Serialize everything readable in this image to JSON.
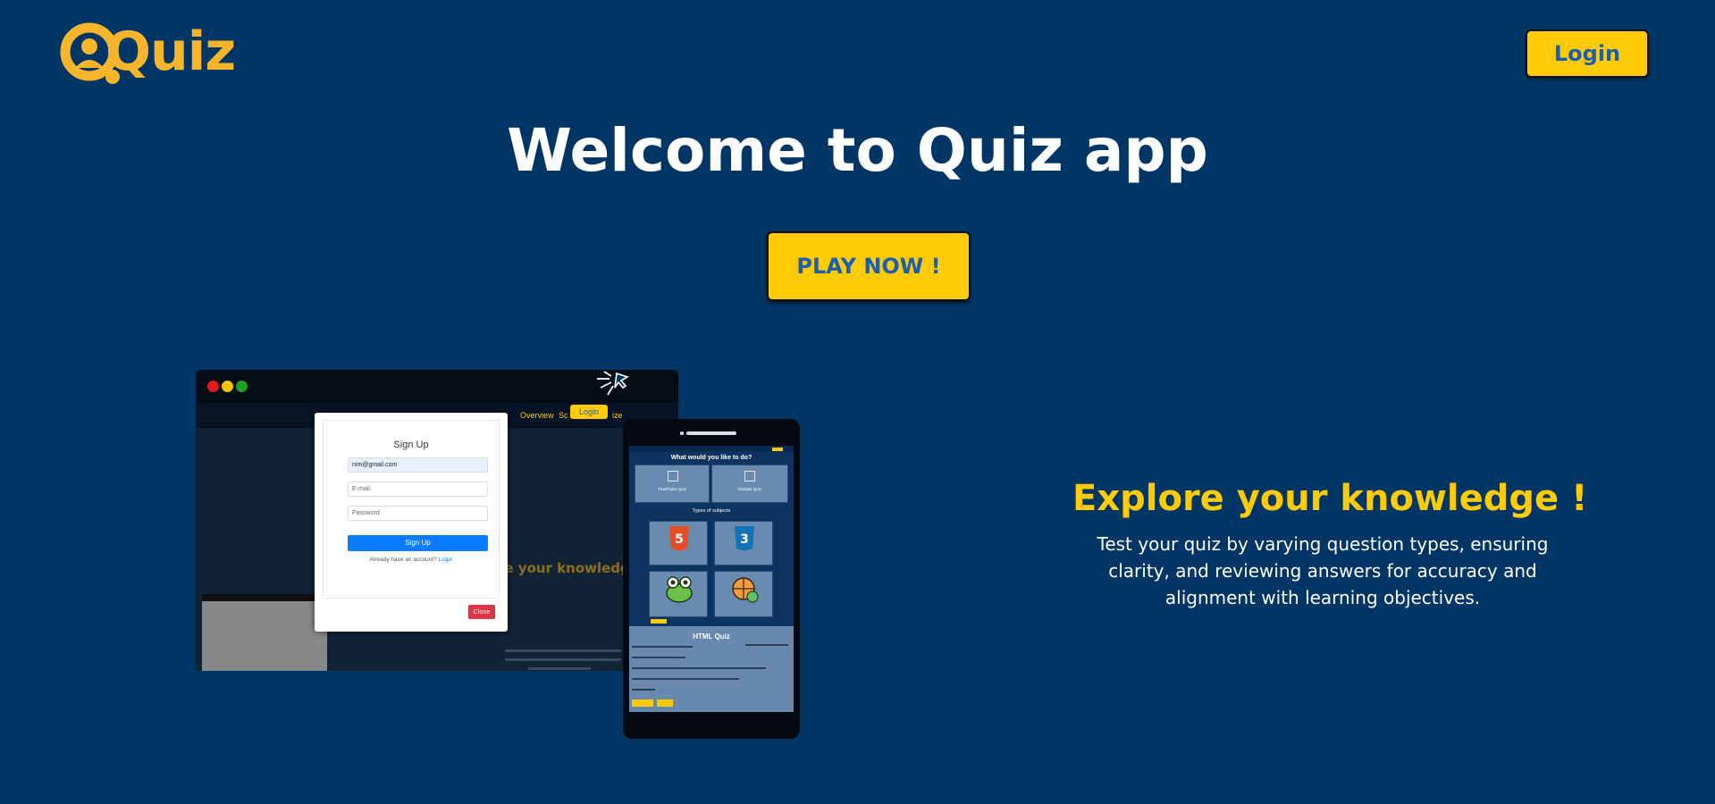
{
  "header": {
    "logo_text": "Quiz",
    "login_label": "Login"
  },
  "hero": {
    "title": "Welcome to Quiz app",
    "play_label": "PLAY NOW !"
  },
  "desktop_mockup": {
    "nav_items": [
      "Overview",
      "Sc",
      "ize"
    ],
    "login_label": "Login",
    "ghost_heading": "re your knowledge",
    "signup_modal": {
      "title": "Sign Up",
      "email_value": "nim@gmail.com",
      "email_placeholder": "E-mail",
      "password_placeholder": "Password",
      "submit_label": "Sign Up",
      "already_text": "Already have an account?",
      "login_link": "Login",
      "close_label": "Close"
    }
  },
  "phone_mockup": {
    "heading": "What would you like to do?",
    "option_true_false": "True/False Quiz",
    "option_multiple": "Multiple Quiz",
    "subjects_heading": "Types of subjects",
    "quiz_title": "HTML Quiz"
  },
  "explore": {
    "title": "Explore your knowledge !",
    "text": "Test your quiz by varying question types, ensuring clarity, and reviewing answers for accuracy and alignment with learning objectives."
  },
  "colors": {
    "background": "#003666",
    "accent": "#FFCB05",
    "logo": "#F7B52C",
    "button_text": "#1b5fb0"
  }
}
